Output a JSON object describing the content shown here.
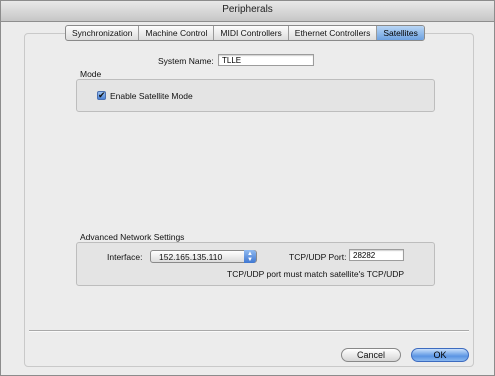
{
  "window": {
    "title": "Peripherals"
  },
  "tabs": [
    {
      "label": "Synchronization",
      "active": false
    },
    {
      "label": "Machine Control",
      "active": false
    },
    {
      "label": "MIDI Controllers",
      "active": false
    },
    {
      "label": "Ethernet Controllers",
      "active": false
    },
    {
      "label": "Satellites",
      "active": true
    }
  ],
  "system_name": {
    "label": "System Name:",
    "value": "TLLE"
  },
  "mode": {
    "heading": "Mode",
    "enable_satellite": {
      "label": "Enable Satellite Mode",
      "checked": true
    }
  },
  "advanced": {
    "heading": "Advanced Network Settings",
    "interface_label": "Interface:",
    "interface_value": "152.165.135.110",
    "port_label": "TCP/UDP Port:",
    "port_value": "28282",
    "note": "TCP/UDP port must match satellite's TCP/UDP"
  },
  "buttons": {
    "cancel": "Cancel",
    "ok": "OK"
  },
  "colors": {
    "accent": "#5b95e3",
    "tab_active": "#6da1e0"
  }
}
